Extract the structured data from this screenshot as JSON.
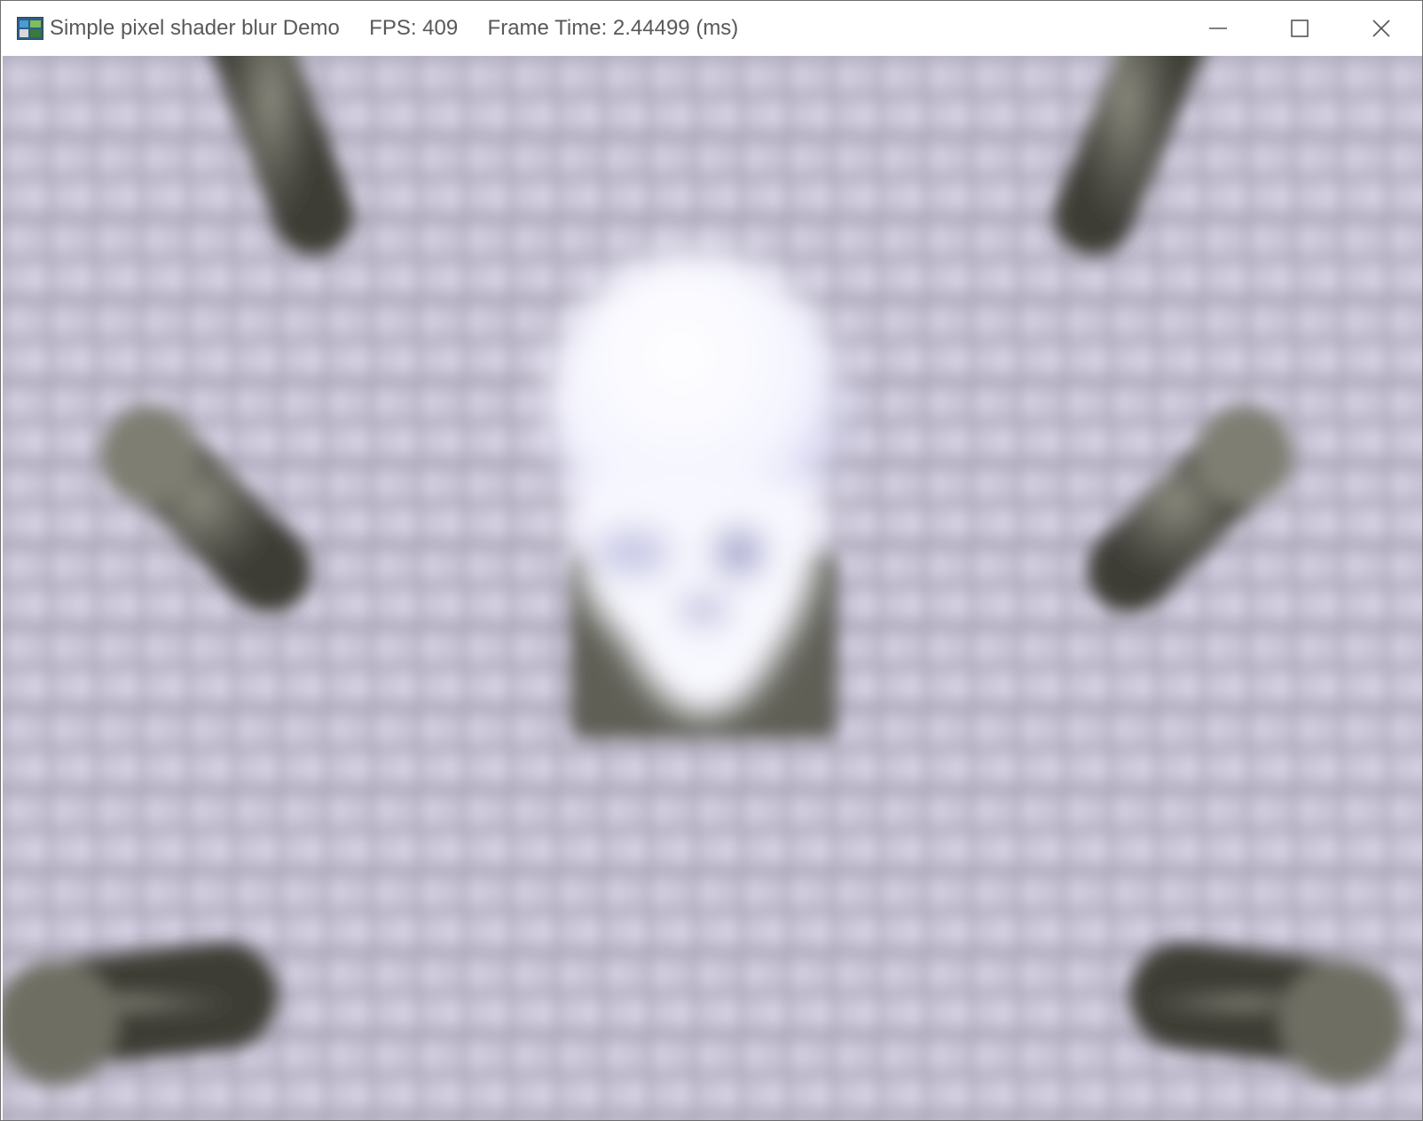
{
  "window": {
    "title": "Simple pixel shader blur Demo     FPS: 409     Frame Time: 2.44499 (ms)"
  },
  "controls": {
    "minimize_icon": "minimize-icon",
    "maximize_icon": "maximize-icon",
    "close_icon": "close-icon"
  },
  "scene": {
    "background_color": "#bdb9c9",
    "tile_light": "#d8d3e6",
    "tile_dark": "#9c98a8",
    "skull_color": "#ffffff",
    "pillar_color": "#5a5a52"
  }
}
